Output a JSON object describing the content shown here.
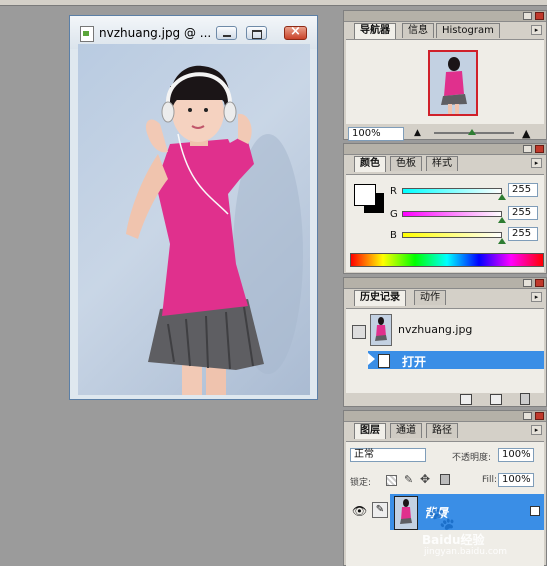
{
  "document": {
    "title": "nvzhuang.jpg @ ..."
  },
  "navigator": {
    "tabs": [
      "导航器",
      "信息",
      "Histogram"
    ],
    "zoom": "100%"
  },
  "color": {
    "tabs": [
      "颜色",
      "色板",
      "样式"
    ],
    "channels": [
      {
        "label": "R",
        "value": "255"
      },
      {
        "label": "G",
        "value": "255"
      },
      {
        "label": "B",
        "value": "255"
      }
    ]
  },
  "history": {
    "tabs": [
      "历史记录",
      "动作"
    ],
    "snapshot": "nvzhuang.jpg",
    "step": "打开"
  },
  "layers": {
    "tabs": [
      "图层",
      "通道",
      "路径"
    ],
    "mode": "正常",
    "opacity_label": "不透明度:",
    "opacity": "100%",
    "lock_label": "锁定:",
    "fill_label": "Fill:",
    "fill": "100%",
    "layer_name": "背景"
  },
  "watermark": {
    "brand": "Baidu经验",
    "url": "jingyan.baidu.com"
  },
  "colors": {
    "accent": "#3a8ee6",
    "shirt": "#e0308d",
    "panel": "#d4d0c8"
  },
  "icons": [
    "file-icon",
    "minimize-icon",
    "maximize-icon",
    "close-icon",
    "eye-icon",
    "brush-icon",
    "lock-icon",
    "trash-icon",
    "new-icon",
    "snapshot-icon"
  ]
}
